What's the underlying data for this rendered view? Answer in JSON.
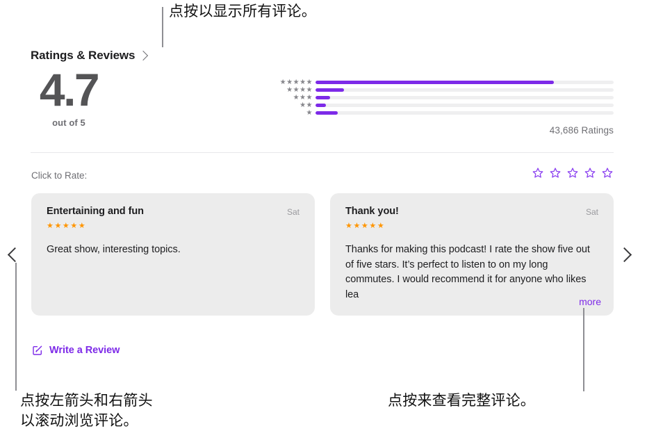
{
  "section": {
    "header_title": "Ratings & Reviews",
    "chevron_icon": "chevron-right-icon",
    "score": "4.7",
    "score_caption": "out of 5",
    "ratings_count": "43,686 Ratings",
    "click_to_rate_label": "Click to Rate:"
  },
  "histogram": {
    "rows": [
      {
        "stars_label": "★★★★★",
        "stars": 5,
        "percent": 80
      },
      {
        "stars_label": "★★★★",
        "stars": 4,
        "percent": 9.5
      },
      {
        "stars_label": "★★★",
        "stars": 3,
        "percent": 5
      },
      {
        "stars_label": "★★",
        "stars": 2,
        "percent": 3.5
      },
      {
        "stars_label": "★",
        "stars": 1,
        "percent": 7.5
      }
    ]
  },
  "rate_stars": {
    "count": 5,
    "icon": "star-outline-icon",
    "color": "#8a3ff0"
  },
  "reviews": [
    {
      "title": "Entertaining and fun",
      "date": "Sat",
      "stars_label": "★★★★★",
      "stars": 5,
      "body": "Great show, interesting topics.",
      "truncated": false
    },
    {
      "title": "Thank you!",
      "date": "Sat",
      "stars_label": "★★★★★",
      "stars": 5,
      "body": "Thanks for making this podcast! I rate the show five out of five stars. It’s perfect to listen to on my long commutes. I would recommend it for anyone who likes lea",
      "truncated": true,
      "more_label": "more"
    }
  ],
  "nav": {
    "left_icon": "chevron-left-icon",
    "right_icon": "chevron-right-icon"
  },
  "write_review": {
    "icon": "compose-square-pencil-icon",
    "label": "Write a Review"
  },
  "callouts": [
    {
      "id": "show-all-reviews",
      "text": "点按以显示所有评论。"
    },
    {
      "id": "scroll-arrows",
      "text": "点按左箭头和右箭头\n以滚动浏览评论。"
    },
    {
      "id": "view-full-review",
      "text": "点按来查看完整评论。"
    }
  ],
  "colors": {
    "accent_purple": "#7d2ae8",
    "star_orange": "#ff9500",
    "card_bg": "#ececec"
  }
}
